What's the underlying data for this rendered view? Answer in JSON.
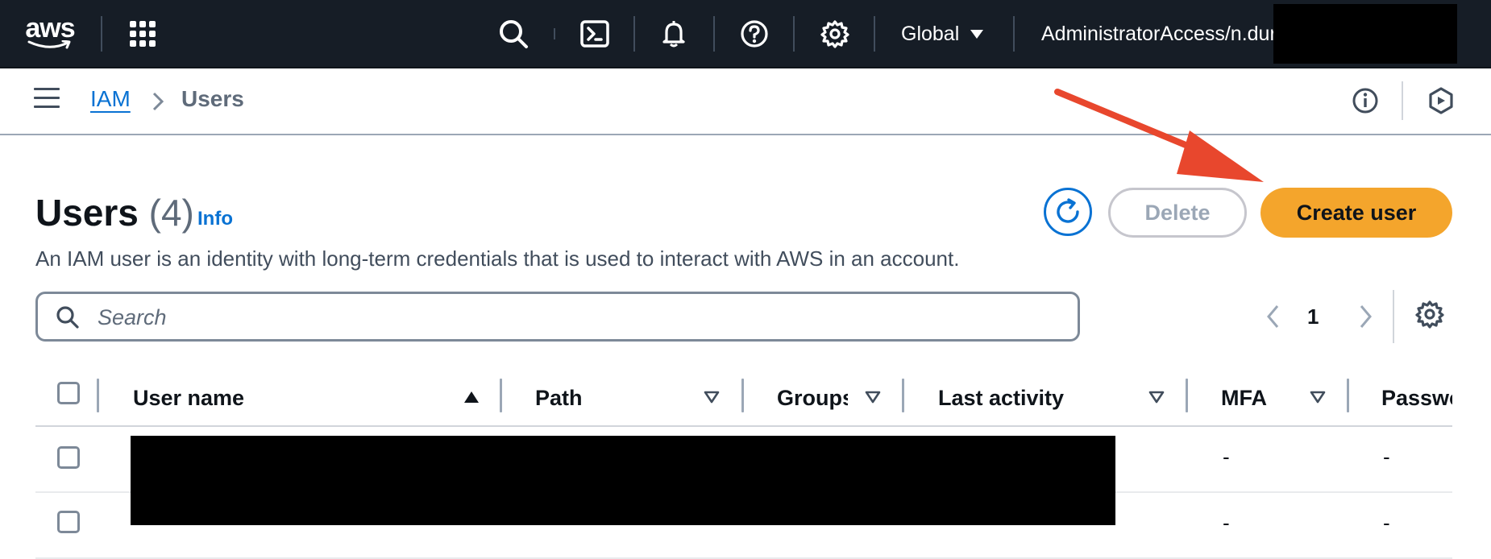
{
  "topnav": {
    "logo_text": "aws",
    "region": "Global",
    "account": "AdministratorAccess/n.dur"
  },
  "breadcrumb": {
    "items": [
      "IAM",
      "Users"
    ]
  },
  "header": {
    "title": "Users",
    "count": "(4)",
    "info_link": "Info",
    "description": "An IAM user is an identity with long-term credentials that is used to interact with AWS in an account.",
    "delete_label": "Delete",
    "create_label": "Create user"
  },
  "search": {
    "placeholder": "Search",
    "value": ""
  },
  "pagination": {
    "current_page": "1"
  },
  "table": {
    "columns": [
      "User name",
      "Path",
      "Groups",
      "Last activity",
      "MFA",
      "Passwo"
    ],
    "rows": [
      {
        "mfa": "-",
        "password": "-"
      },
      {
        "mfa": "-",
        "password": "-"
      }
    ]
  },
  "colors": {
    "nav_bg": "#161d26",
    "accent_blue": "#0972d3",
    "primary_button": "#f4a52c",
    "annotation_arrow": "#e8472d"
  },
  "icons": [
    "aws-logo",
    "apps-grid-icon",
    "search-icon",
    "cloudshell-icon",
    "bell-icon",
    "help-icon",
    "gear-icon",
    "menu-icon",
    "info-circle-icon",
    "feedback-icon",
    "refresh-icon",
    "chevron-left-icon",
    "chevron-right-icon",
    "sort-ascending-icon",
    "sort-descending-icon"
  ]
}
